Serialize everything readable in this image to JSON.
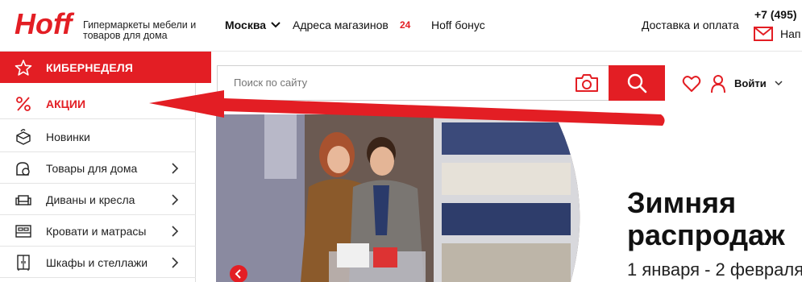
{
  "header": {
    "logo_text": "Hoff",
    "tagline": "Гипермаркеты мебели и товаров для дома",
    "city": "Москва",
    "stores_link": "Адреса магазинов",
    "stores_count": "24",
    "bonus_link": "Hoff бонус",
    "delivery_link": "Доставка и оплата",
    "phone": "+7 (495)",
    "mail_text": "Нап"
  },
  "sidebar": {
    "items": [
      {
        "label": "КИБЕРНЕДЕЛЯ",
        "icon": "star-icon"
      },
      {
        "label": "АКЦИИ",
        "icon": "percent-icon"
      },
      {
        "label": "Новинки",
        "icon": "box-icon"
      },
      {
        "label": "Товары для дома",
        "icon": "home-goods-icon"
      },
      {
        "label": "Диваны и кресла",
        "icon": "sofa-icon"
      },
      {
        "label": "Кровати и матрасы",
        "icon": "bed-icon"
      },
      {
        "label": "Шкафы и стеллажи",
        "icon": "wardrobe-icon"
      }
    ]
  },
  "search": {
    "placeholder": "Поиск по сайту"
  },
  "account": {
    "login_label": "Войти"
  },
  "banner": {
    "title_line1": "Зимняя",
    "title_line2": "распродаж",
    "dates": "1 января - 2 февраля"
  },
  "colors": {
    "brand_red": "#e31e24"
  }
}
